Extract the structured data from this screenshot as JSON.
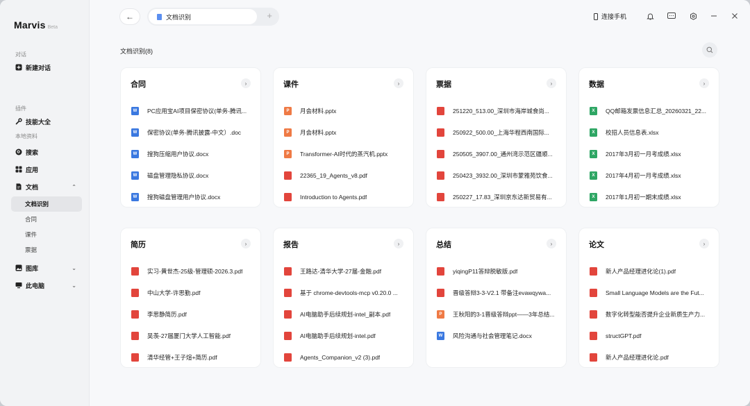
{
  "sidebar": {
    "brand": "Marvis",
    "beta": "Beta",
    "section_chat": "对话",
    "new_chat": "新建对话",
    "section_plugins": "插件",
    "skills": "技能大全",
    "section_local": "本地资料",
    "search": "搜索",
    "apps": "应用",
    "docs": "文档",
    "doc_sub": [
      "文档识别",
      "合同",
      "课件",
      "票据"
    ],
    "gallery": "图库",
    "computer": "此电脑"
  },
  "topbar": {
    "tab_label": "文档识别",
    "add_tab": "+",
    "connect_phone": "连接手机"
  },
  "page_title": "文档识别(8)",
  "cards": [
    {
      "title": "合同",
      "files": [
        {
          "type": "word",
          "name": "PC应用宝AI项目保密协议(单务-腾讯..."
        },
        {
          "type": "word",
          "name": "保密协议(单务-腾讯披露-中文）.doc"
        },
        {
          "type": "word",
          "name": "搜狗压缩用户协议.docx"
        },
        {
          "type": "word",
          "name": "磁盘管理隐私协议.docx"
        },
        {
          "type": "word",
          "name": "搜狗磁盘管理用户协议.docx"
        }
      ]
    },
    {
      "title": "课件",
      "files": [
        {
          "type": "ppt",
          "name": "月会材料.pptx"
        },
        {
          "type": "ppt",
          "name": "月会材料.pptx"
        },
        {
          "type": "ppt",
          "name": "Transformer-AI时代的蒸汽机.pptx"
        },
        {
          "type": "pdf",
          "name": "22365_19_Agents_v8.pdf"
        },
        {
          "type": "pdf",
          "name": "Introduction to Agents.pdf"
        }
      ]
    },
    {
      "title": "票据",
      "files": [
        {
          "type": "pdf",
          "name": "251220_513.00_深圳市海岸城食尚..."
        },
        {
          "type": "pdf",
          "name": "250922_500.00_上海华程西南国际..."
        },
        {
          "type": "pdf",
          "name": "250505_3907.00_通州湾示范区疆顺..."
        },
        {
          "type": "pdf",
          "name": "250423_3932.00_深圳市蒙雅苑饮食..."
        },
        {
          "type": "pdf",
          "name": "250227_17.83_深圳京东达新贸易有..."
        }
      ]
    },
    {
      "title": "数据",
      "files": [
        {
          "type": "xls",
          "name": "QQ邮箱发票信息汇总_20260321_22..."
        },
        {
          "type": "xls",
          "name": "校招人员信息表.xlsx"
        },
        {
          "type": "xls",
          "name": "2017年3月初一月考成绩.xlsx"
        },
        {
          "type": "xls",
          "name": "2017年4月初一月考成绩.xlsx"
        },
        {
          "type": "xls",
          "name": "2017年1月初一期末成绩.xlsx"
        }
      ]
    },
    {
      "title": "简历",
      "files": [
        {
          "type": "pdf",
          "name": "实习-黄世杰-25级-管理硕-2026.3.pdf"
        },
        {
          "type": "pdf",
          "name": "中山大学-许思勤.pdf"
        },
        {
          "type": "pdf",
          "name": "李思静简历.pdf"
        },
        {
          "type": "pdf",
          "name": "吴羡-27届厦门大学人工智能.pdf"
        },
        {
          "type": "pdf",
          "name": "清华经管+王子煊+简历.pdf"
        }
      ]
    },
    {
      "title": "报告",
      "files": [
        {
          "type": "pdf",
          "name": "王路达-清华大学-27届-金融.pdf"
        },
        {
          "type": "pdf",
          "name": "基于 chrome-devtools-mcp v0.20.0 ..."
        },
        {
          "type": "pdf",
          "name": "AI电脑助手后续规划-intel_副本.pdf"
        },
        {
          "type": "pdf",
          "name": "AI电脑助手后续规划-intel.pdf"
        },
        {
          "type": "pdf",
          "name": "Agents_Companion_v2 (3).pdf"
        }
      ]
    },
    {
      "title": "总结",
      "files": [
        {
          "type": "pdf",
          "name": "yiqingP11答辩脱敏版.pdf"
        },
        {
          "type": "pdf",
          "name": "晋级答辩3-3-V2.1 带备注evawqywa..."
        },
        {
          "type": "ppt",
          "name": "王秋阳的3-1晋级答辩ppt——3年总结..."
        },
        {
          "type": "word",
          "name": "风险沟通与社会管理笔记.docx"
        }
      ]
    },
    {
      "title": "论文",
      "files": [
        {
          "type": "pdf",
          "name": "新人产品经理进化论(1).pdf"
        },
        {
          "type": "pdf",
          "name": "Small Language Models are the Fut..."
        },
        {
          "type": "pdf",
          "name": "数字化转型能否提升企业新质生产力..."
        },
        {
          "type": "pdf",
          "name": "structGPT.pdf"
        },
        {
          "type": "pdf",
          "name": "新人产品经理进化论.pdf"
        }
      ]
    }
  ],
  "icons": {
    "word": "W",
    "ppt": "P",
    "pdf": "",
    "xls": "X"
  }
}
